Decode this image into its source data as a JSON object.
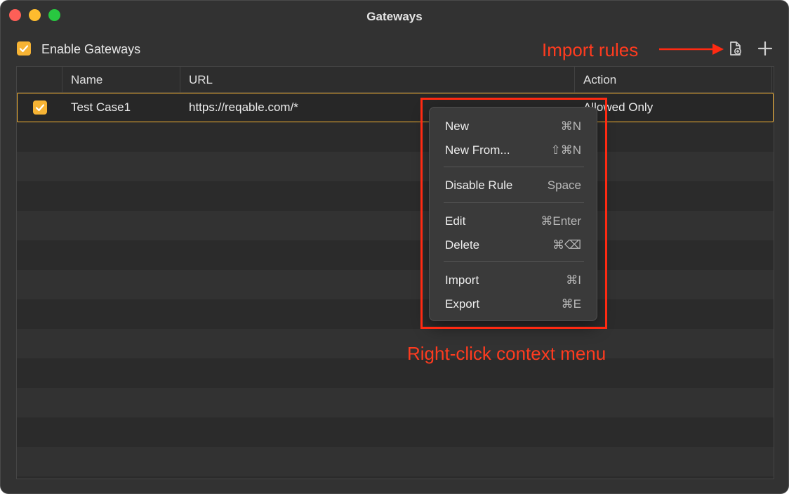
{
  "window": {
    "title": "Gateways"
  },
  "toolbar": {
    "enable_label": "Enable Gateways",
    "enable_checked": true,
    "import_icon": "document-import-icon",
    "add_icon": "plus-icon"
  },
  "annotations": {
    "import_rules": "Import rules",
    "context_menu": "Right-click context menu",
    "color": "#ff2a12"
  },
  "table": {
    "columns": [
      "",
      "Name",
      "URL",
      "Action"
    ],
    "rows": [
      {
        "checked": true,
        "name": "Test Case1",
        "url": "https://reqable.com/*",
        "action": "Allowed Only"
      }
    ]
  },
  "context_menu": {
    "items": [
      {
        "label": "New",
        "shortcut": "⌘N"
      },
      {
        "label": "New From...",
        "shortcut": "⇧⌘N"
      },
      {
        "label": "Disable Rule",
        "shortcut": "Space"
      },
      {
        "label": "Edit",
        "shortcut": "⌘Enter"
      },
      {
        "label": "Delete",
        "shortcut": "⌘⌫"
      },
      {
        "label": "Import",
        "shortcut": "⌘I"
      },
      {
        "label": "Export",
        "shortcut": "⌘E"
      }
    ]
  },
  "colors": {
    "accent": "#f6b334",
    "background": "#323232"
  }
}
